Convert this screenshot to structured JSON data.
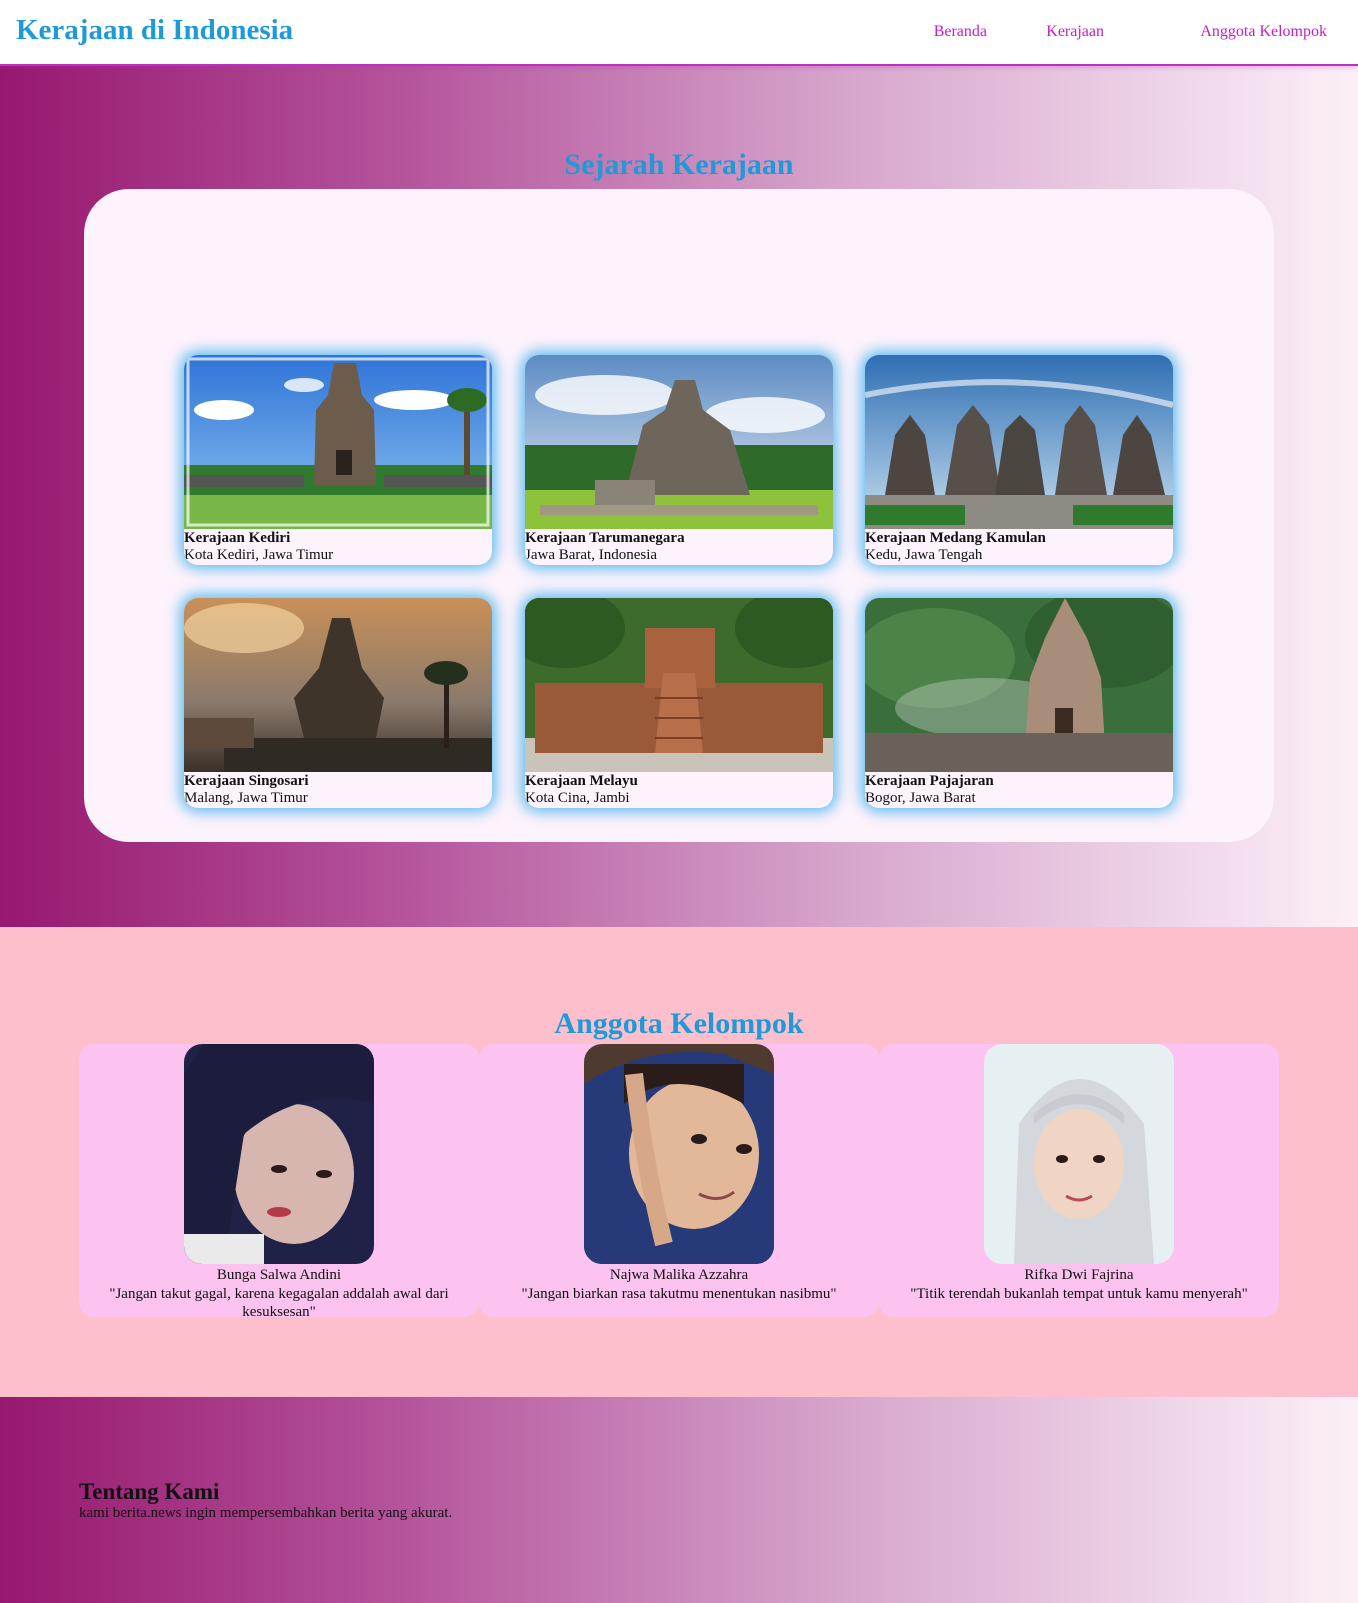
{
  "header": {
    "brand": "Kerajaan di Indonesia",
    "nav": [
      "Beranda",
      "Kerajaan",
      "Anggota Kelompok"
    ]
  },
  "history": {
    "title": "Sejarah Kerajaan",
    "cards": [
      {
        "name": "Kerajaan Kediri",
        "location": "Kota Kediri, Jawa Timur"
      },
      {
        "name": "Kerajaan Tarumanegara",
        "location": "Jawa Barat, Indonesia"
      },
      {
        "name": "Kerajaan Medang Kamulan",
        "location": "Kedu, Jawa Tengah"
      },
      {
        "name": "Kerajaan Singosari",
        "location": "Malang, Jawa Timur"
      },
      {
        "name": "Kerajaan Melayu",
        "location": "Kota Cina, Jambi"
      },
      {
        "name": "Kerajaan Pajajaran",
        "location": "Bogor, Jawa Barat"
      }
    ]
  },
  "members": {
    "title": "Anggota Kelompok",
    "list": [
      {
        "name": "Bunga Salwa Andini",
        "quote": "\"Jangan takut gagal, karena kegagalan addalah awal dari kesuksesan\""
      },
      {
        "name": "Najwa Malika Azzahra",
        "quote": "\"Jangan biarkan rasa takutmu menentukan nasibmu\""
      },
      {
        "name": "Rifka Dwi Fajrina",
        "quote": "\"Titik terendah bukanlah tempat untuk kamu menyerah\""
      }
    ]
  },
  "footer": {
    "title": "Tentang Kami",
    "text": "kami berita.news ingin mempersembahkan berita yang akurat."
  },
  "colors": {
    "accent": "#1e9ad6",
    "nav_link": "#c41dc9",
    "card_glow": "#28aaeb",
    "members_bg": "#fdbfcc",
    "member_card": "#fcc2f0"
  }
}
